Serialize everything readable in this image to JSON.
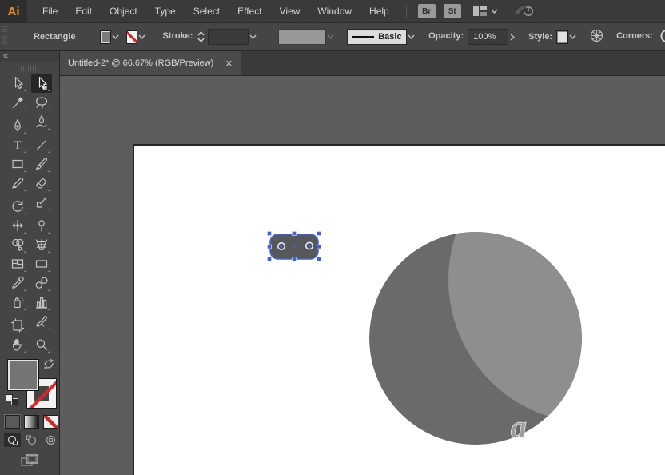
{
  "app": {
    "logo_text": "Ai",
    "menu_items": [
      "File",
      "Edit",
      "Object",
      "Type",
      "Select",
      "Effect",
      "View",
      "Window",
      "Help"
    ],
    "bridge_label": "Br",
    "stock_label": "St"
  },
  "control_bar": {
    "object_label": "Rectangle",
    "stroke_label": "Stroke:",
    "brush_name": "Basic",
    "opacity_label": "Opacity:",
    "opacity_value": "100%",
    "style_label": "Style:",
    "corners_label": "Corners:"
  },
  "document_tab": {
    "title": "Untitled-2* @ 66.67% (RGB/Preview)",
    "close_glyph": "✕"
  },
  "toolbar": {
    "collapse_glyph": "«",
    "tools": [
      {
        "id": "selection-tool"
      },
      {
        "id": "direct-selection-tool",
        "active": true
      },
      {
        "id": "magic-wand-tool"
      },
      {
        "id": "lasso-tool"
      },
      {
        "id": "pen-tool"
      },
      {
        "id": "curvature-tool"
      },
      {
        "id": "type-tool"
      },
      {
        "id": "line-segment-tool"
      },
      {
        "id": "rectangle-tool"
      },
      {
        "id": "paintbrush-tool"
      },
      {
        "id": "shaper-tool"
      },
      {
        "id": "eraser-tool"
      },
      {
        "id": "rotate-tool"
      },
      {
        "id": "scale-tool"
      },
      {
        "id": "width-tool"
      },
      {
        "id": "puppet-warp-tool"
      },
      {
        "id": "shape-builder-tool"
      },
      {
        "id": "perspective-grid-tool"
      },
      {
        "id": "mesh-tool"
      },
      {
        "id": "gradient-tool"
      },
      {
        "id": "eyedropper-tool"
      },
      {
        "id": "blend-tool"
      },
      {
        "id": "symbol-sprayer-tool"
      },
      {
        "id": "column-graph-tool"
      },
      {
        "id": "artboard-tool"
      },
      {
        "id": "slice-tool"
      },
      {
        "id": "hand-tool"
      },
      {
        "id": "zoom-tool"
      }
    ]
  },
  "canvas": {
    "watermark_glyph": "a"
  },
  "colors": {
    "accent_orange": "#E8902A",
    "selection_blue": "#3F63DC",
    "object_gray": "#57585A",
    "circle_dark": "#6A6A6A",
    "circle_light": "#8E8E8E",
    "none_red": "#D42A2A",
    "artboard_white": "#FFFFFF"
  }
}
